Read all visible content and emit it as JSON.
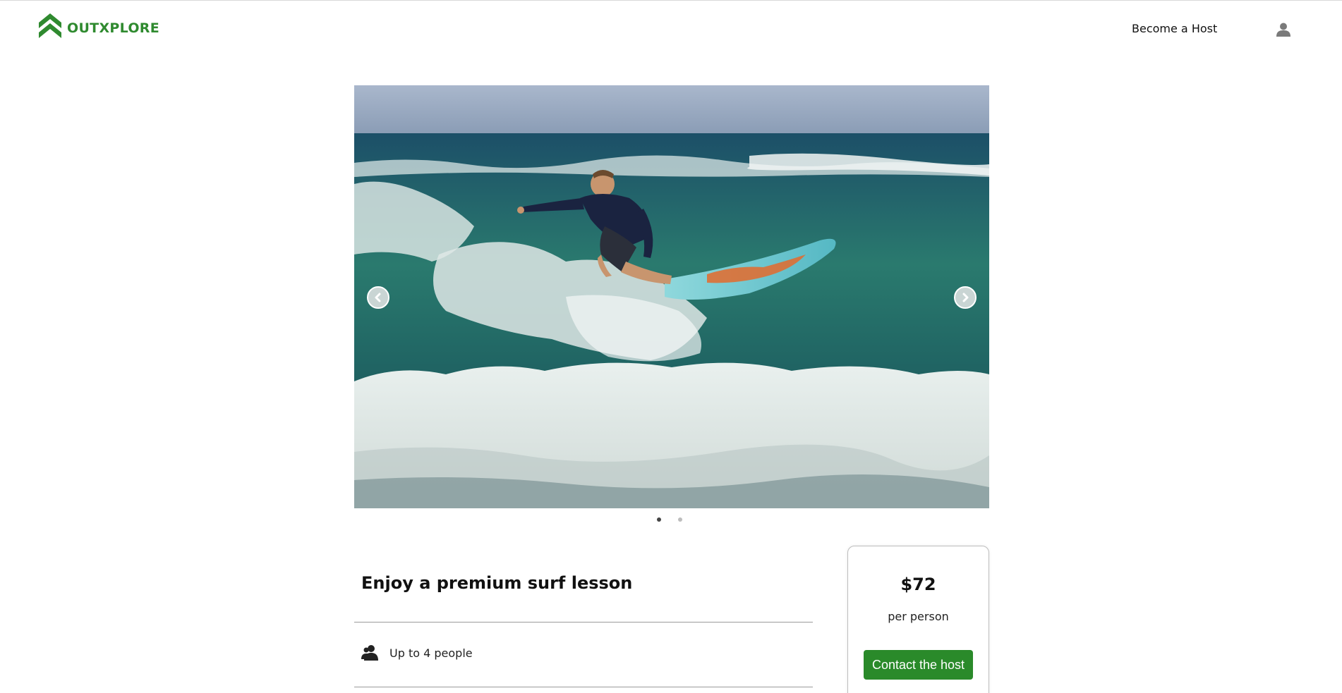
{
  "brand": {
    "name": "OUTXPLORE",
    "color": "#2f8a2f"
  },
  "header": {
    "become_host": "Become a Host",
    "user_icon": "user-icon"
  },
  "carousel": {
    "image_alt": "Surfer riding a wave on a turquoise surfboard",
    "prev_icon": "chevron-left-icon",
    "next_icon": "chevron-right-icon",
    "slide_count": 2,
    "active_slide": 1
  },
  "listing": {
    "title": "Enjoy a premium surf lesson",
    "capacity_icon": "people-icon",
    "capacity": "Up to 4 people"
  },
  "booking": {
    "price": "$72",
    "per": "per person",
    "cta": "Contact the host",
    "cta_color": "#2a8a2a"
  }
}
